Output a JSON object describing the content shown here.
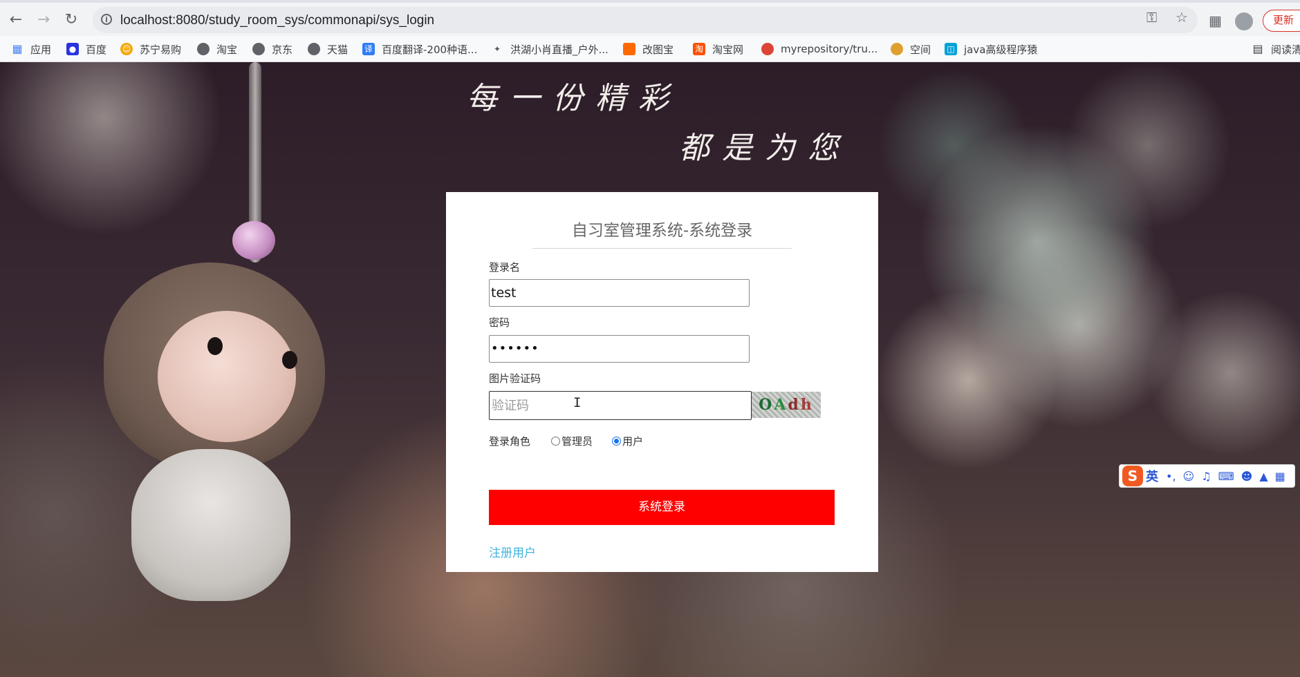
{
  "browser": {
    "url": "localhost:8080/study_room_sys/commonapi/sys_login",
    "update_label": "更新",
    "bookmarks": [
      {
        "label": "应用",
        "icon": "apps-grid-icon",
        "color": "#4285f4"
      },
      {
        "label": "百度",
        "icon": "baidu-paw-icon",
        "color": "#2932e1"
      },
      {
        "label": "苏宁易购",
        "icon": "suning-icon",
        "color": "#f2a80c"
      },
      {
        "label": "淘宝",
        "icon": "globe-icon",
        "color": "#5f6368"
      },
      {
        "label": "京东",
        "icon": "globe-icon",
        "color": "#5f6368"
      },
      {
        "label": "天猫",
        "icon": "globe-icon",
        "color": "#5f6368"
      },
      {
        "label": "百度翻译-200种语...",
        "icon": "translate-icon",
        "color": "#2e7cf6"
      },
      {
        "label": "洪湖小肖直播_户外...",
        "icon": "bookmark-generic-icon",
        "color": "#555555"
      },
      {
        "label": "改图宝",
        "icon": "gaitubao-icon",
        "color": "#ff6a00"
      },
      {
        "label": "淘宝网",
        "icon": "taobao-icon",
        "color": "#ff5000"
      },
      {
        "label": "myrepository/tru...",
        "icon": "chrome-icon",
        "color": "#db4437"
      },
      {
        "label": "空间",
        "icon": "qzone-icon",
        "color": "#e0a030"
      },
      {
        "label": "java高级程序猿",
        "icon": "bilibili-icon",
        "color": "#00a1d6"
      }
    ],
    "reading_list_label": "阅读清"
  },
  "background": {
    "slogan_line1": "每一份精彩",
    "slogan_line2": "都是为您"
  },
  "login": {
    "title": "自习室管理系统-系统登录",
    "username_label": "登录名",
    "username_value": "test",
    "password_label": "密码",
    "password_masked": "••••••",
    "captcha_label": "图片验证码",
    "captcha_placeholder": "验证码",
    "captcha_text": [
      "O",
      "A",
      "d",
      "h"
    ],
    "role_label": "登录角色",
    "role_options": [
      "管理员",
      "用户"
    ],
    "role_selected": "用户",
    "submit_label": "系统登录",
    "register_label": "注册用户",
    "submit_color": "#ff0000",
    "link_color": "#43b3e0"
  },
  "ime": {
    "logo": "S",
    "mode": "英",
    "icons": [
      "punctuation-icon",
      "emoji-icon",
      "microphone-icon",
      "keyboard-icon",
      "user-icon",
      "skin-icon",
      "toolbox-icon"
    ]
  }
}
